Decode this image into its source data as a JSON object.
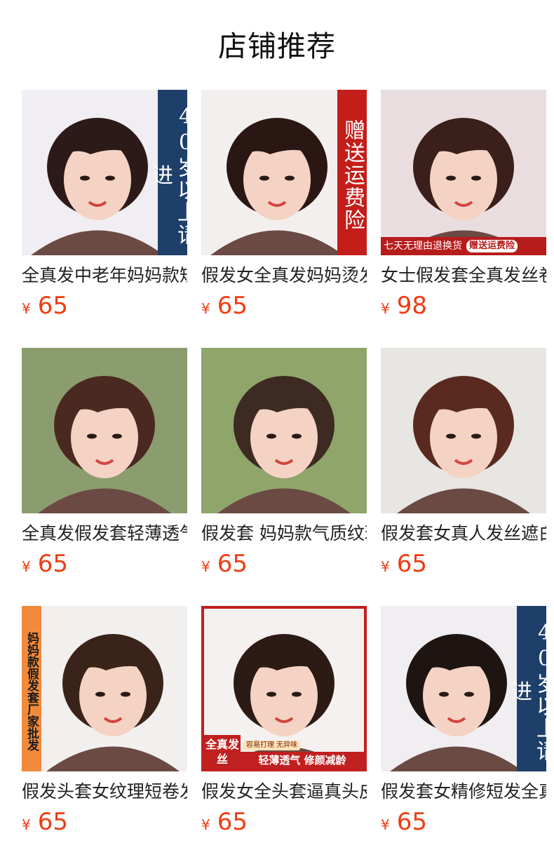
{
  "page": {
    "title": "店铺推荐"
  },
  "colors": {
    "price": "#ee3d14",
    "banner_blue": "#1d3f6a",
    "banner_red": "#c41e1a",
    "banner_orange": "#f28a3b"
  },
  "currency": "¥",
  "products": [
    {
      "name": "全真发中老年妈妈款短发",
      "price": "65",
      "banner": "40岁以上请进",
      "banner_style": "blue",
      "hair": "#2b1a17",
      "bg": "#f1eef3"
    },
    {
      "name": "假发女全真发妈妈烫发短",
      "price": "65",
      "banner": "赠送运费险",
      "banner_style": "red",
      "hair": "#2a1714",
      "bg": "#f3efee"
    },
    {
      "name": "女士假发套全真发丝卷发",
      "price": "98",
      "strip_text": "七天无理由退换货",
      "strip_pill": "赠送运费险",
      "hair": "#3a1f1a",
      "bg": "#eadde0"
    },
    {
      "name": "全真发假发套轻薄透气短",
      "price": "65",
      "hair": "#4a2a20",
      "bg": "#8b9d6e"
    },
    {
      "name": "假发套 妈妈款气质纹理短",
      "price": "65",
      "hair": "#3d2a22",
      "bg": "#8fa56a"
    },
    {
      "name": "假发套女真人发丝遮白发",
      "price": "65",
      "hair": "#5a2a20",
      "bg": "#e8e6e3"
    },
    {
      "name": "假发头套女纹理短卷发全",
      "price": "65",
      "banner": "妈妈款假发套厂家批发",
      "banner_style": "orange",
      "hair": "#3a2419",
      "bg": "#f2f0ee"
    },
    {
      "name": "假发女全头套逼真头皮短",
      "price": "65",
      "promo_left": "全真发丝",
      "promo_small": "容易打理 无异味",
      "promo_main": "轻薄透气 修颜减龄",
      "hair": "#2c1a14",
      "bg": "#f4f1f0"
    },
    {
      "name": "假发套女精修短发全真发",
      "price": "65",
      "banner": "40岁以上请进",
      "banner_style": "blue",
      "hair": "#1e1512",
      "bg": "#f0eef1"
    }
  ]
}
